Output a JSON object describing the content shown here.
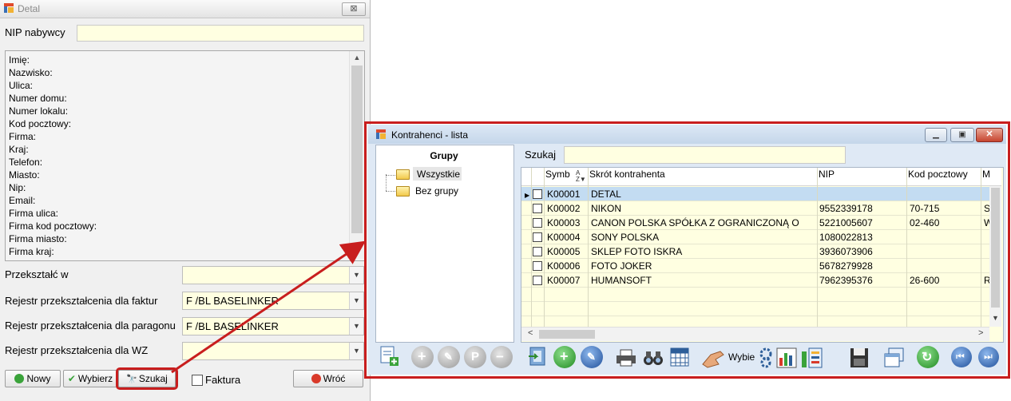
{
  "detal": {
    "title": "Detal",
    "close_glyph": "⊠",
    "nip_label": "NIP nabywcy",
    "nip_value": "",
    "info_rows": [
      "Imię:",
      "Nazwisko:",
      "Ulica:",
      "Numer domu:",
      "Numer lokalu:",
      "Kod pocztowy:",
      "Firma:",
      "Kraj:",
      "Telefon:",
      "Miasto:",
      "Nip:",
      "Email:",
      "Firma ulica:",
      "Firma kod pocztowy:",
      "Firma miasto:",
      "Firma kraj:"
    ],
    "fields": [
      {
        "label": "Przekształć w",
        "value": ""
      },
      {
        "label": "Rejestr przekształcenia dla faktur",
        "value": "F /BL BASELINKER"
      },
      {
        "label": "Rejestr przekształcenia dla paragonu",
        "value": "F /BL BASELINKER"
      },
      {
        "label": "Rejestr przekształcenia dla WZ",
        "value": ""
      }
    ],
    "buttons": {
      "nowy": "Nowy",
      "wybierz": "Wybierz",
      "szukaj": "Szukaj",
      "wroc": "Wróć"
    },
    "faktura_label": "Faktura",
    "faktura_checked": false
  },
  "kontrahenci": {
    "title": "Kontrahenci - lista",
    "groups_title": "Grupy",
    "groups": [
      "Wszystkie",
      "Bez grupy"
    ],
    "selected_group": "Wszystkie",
    "search_label": "Szukaj",
    "search_value": "",
    "columns": [
      "Symbol",
      "Skrót kontrahenta",
      "NIP",
      "Kod pocztowy",
      "M"
    ],
    "column_header_shown": [
      "Symb",
      "Skrót kontrahenta",
      "NIP",
      "Kod pocztowy",
      "M"
    ],
    "sort_indicator": "A↓Z",
    "rows": [
      {
        "symbol": "K00001",
        "name": "DETAL",
        "nip": "",
        "kod": "",
        "m": "",
        "selected": true
      },
      {
        "symbol": "K00002",
        "name": "NIKON",
        "nip": "9552339178",
        "kod": "70-715",
        "m": "S"
      },
      {
        "symbol": "K00003",
        "name": "CANON POLSKA SPÓŁKA Z OGRANICZONĄ O",
        "nip": "5221005607",
        "kod": "02-460",
        "m": "W"
      },
      {
        "symbol": "K00004",
        "name": "SONY POLSKA",
        "nip": "1080022813",
        "kod": "",
        "m": ""
      },
      {
        "symbol": "K00005",
        "name": "SKLEP FOTO ISKRA",
        "nip": "3936073906",
        "kod": "",
        "m": ""
      },
      {
        "symbol": "K00006",
        "name": "FOTO JOKER",
        "nip": "5678279928",
        "kod": "",
        "m": ""
      },
      {
        "symbol": "K00007",
        "name": "HUMANSOFT",
        "nip": "7962395376",
        "kod": "26-600",
        "m": "R"
      }
    ],
    "toolbar_text": "Wybie"
  },
  "colors": {
    "highlight_red": "#c81e1e",
    "input_yellow": "#ffffe1",
    "selected_row": "#c3dcf2"
  }
}
